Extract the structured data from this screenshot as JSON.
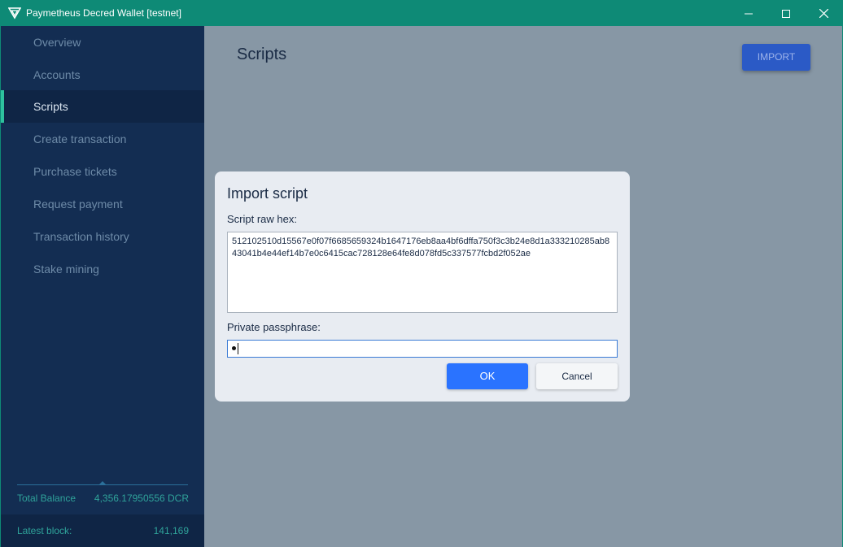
{
  "window": {
    "title": "Paymetheus Decred Wallet [testnet]",
    "accent_color": "#0e8a76"
  },
  "sidebar": {
    "items": [
      {
        "label": "Overview"
      },
      {
        "label": "Accounts"
      },
      {
        "label": "Scripts",
        "active": true
      },
      {
        "label": "Create transaction"
      },
      {
        "label": "Purchase tickets"
      },
      {
        "label": "Request payment"
      },
      {
        "label": "Transaction history"
      },
      {
        "label": "Stake mining"
      }
    ],
    "total_balance_label": "Total Balance",
    "total_balance_value": "4,356.17950556 DCR",
    "latest_block_label": "Latest block:",
    "latest_block_value": "141,169"
  },
  "main": {
    "page_title": "Scripts",
    "import_label": "IMPORT"
  },
  "dialog": {
    "title": "Import script",
    "hex_label": "Script raw hex:",
    "hex_value": "512102510d15567e0f07f6685659324b1647176eb8aa4bf6dffa750f3c3b24e8d1a333210285ab843041b4e44ef14b7e0c6415cac728128e64fe8d078fd5c337577fcbd2f052ae",
    "passphrase_label": "Private passphrase:",
    "ok_label": "OK",
    "cancel_label": "Cancel"
  }
}
